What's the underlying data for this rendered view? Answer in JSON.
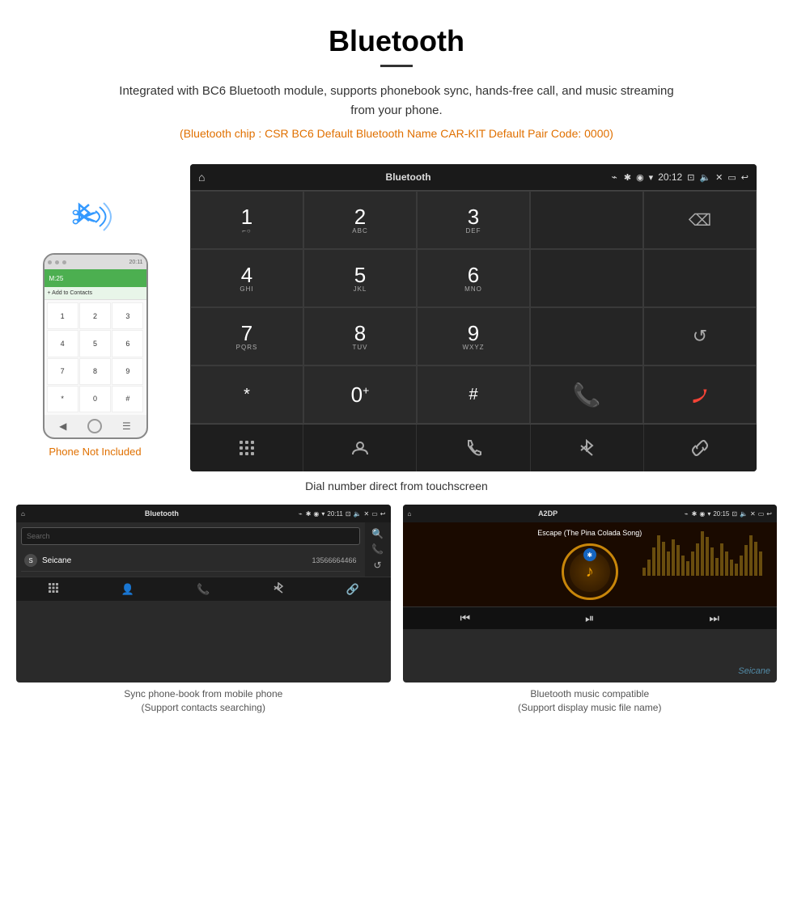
{
  "header": {
    "title": "Bluetooth",
    "subtitle": "Integrated with BC6 Bluetooth module, supports phonebook sync, hands-free call, and music streaming from your phone.",
    "specs": "(Bluetooth chip : CSR BC6   Default Bluetooth Name CAR-KIT    Default Pair Code: 0000)"
  },
  "phone": {
    "not_included_label": "Phone Not Included",
    "screen_title": "M:25",
    "add_contact": "+ Add to Contacts",
    "keys": [
      "1",
      "2",
      "3",
      "4",
      "5",
      "6",
      "7",
      "8",
      "9",
      "*",
      "0",
      "#"
    ]
  },
  "main_screen": {
    "title": "Bluetooth",
    "time": "20:12",
    "usb_icon": "⌁",
    "dialpad": [
      {
        "num": "1",
        "sub": "⌐○"
      },
      {
        "num": "2",
        "sub": "ABC"
      },
      {
        "num": "3",
        "sub": "DEF"
      },
      {
        "num": "",
        "sub": ""
      },
      {
        "num": "⌫",
        "sub": ""
      },
      {
        "num": "4",
        "sub": "GHI"
      },
      {
        "num": "5",
        "sub": "JKL"
      },
      {
        "num": "6",
        "sub": "MNO"
      },
      {
        "num": "",
        "sub": ""
      },
      {
        "num": "",
        "sub": ""
      },
      {
        "num": "7",
        "sub": "PQRS"
      },
      {
        "num": "8",
        "sub": "TUV"
      },
      {
        "num": "9",
        "sub": "WXYZ"
      },
      {
        "num": "",
        "sub": ""
      },
      {
        "num": "↺",
        "sub": ""
      },
      {
        "num": "*",
        "sub": ""
      },
      {
        "num": "0",
        "sub": "+"
      },
      {
        "num": "#",
        "sub": ""
      },
      {
        "num": "📞",
        "sub": ""
      },
      {
        "num": "📵",
        "sub": ""
      }
    ],
    "toolbar_icons": [
      "⊞",
      "👤",
      "📞",
      "✱",
      "🔗"
    ]
  },
  "main_caption": "Dial number direct from touchscreen",
  "phonebook_screen": {
    "title": "Bluetooth",
    "time": "20:11",
    "search_placeholder": "Search",
    "contact_letter": "S",
    "contact_name": "Seicane",
    "contact_number": "13566664466"
  },
  "music_screen": {
    "title": "A2DP",
    "time": "20:15",
    "song_title": "Escape (The Pina Colada Song)"
  },
  "bottom_captions": {
    "phonebook": "Sync phone-book from mobile phone",
    "phonebook_sub": "(Support contacts searching)",
    "music": "Bluetooth music compatible",
    "music_sub": "(Support display music file name)"
  },
  "watermark": "Seicane",
  "eq_heights": [
    10,
    20,
    35,
    50,
    42,
    30,
    45,
    38,
    25,
    18,
    30,
    40,
    55,
    48,
    35,
    22,
    40,
    30,
    20,
    15,
    25,
    38,
    50,
    42,
    30
  ]
}
